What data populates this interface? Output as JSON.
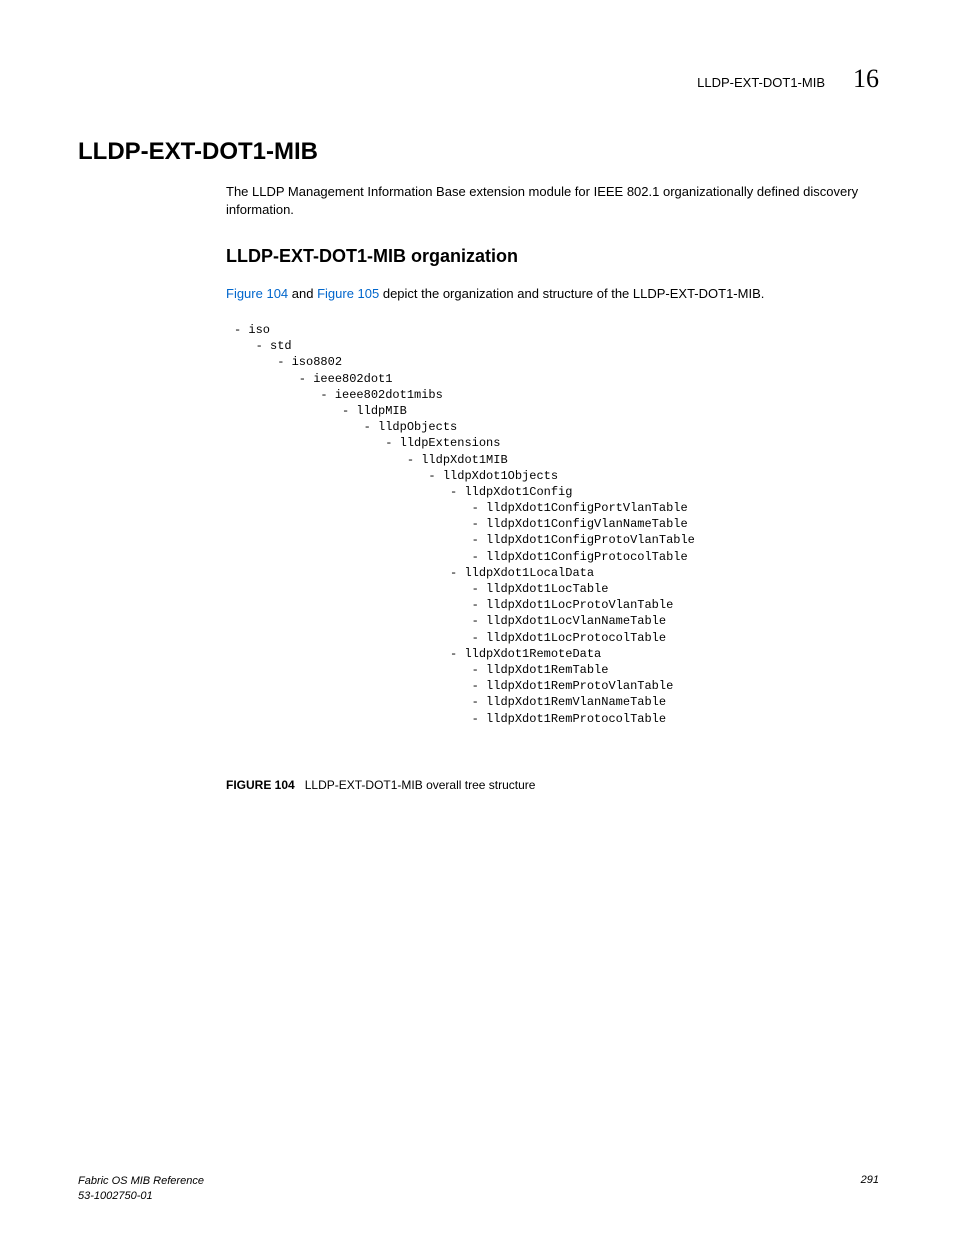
{
  "header": {
    "title": "LLDP-EXT-DOT1-MIB",
    "chapter_number": "16"
  },
  "main": {
    "heading": "LLDP-EXT-DOT1-MIB",
    "intro": "The LLDP Management Information Base extension module for IEEE 802.1 organizationally defined discovery information.",
    "subheading": "LLDP-EXT-DOT1-MIB organization",
    "depict_prefix_link1": "Figure 104",
    "depict_mid": " and ",
    "depict_link2": "Figure 105",
    "depict_suffix": " depict the organization and structure of the LLDP-EXT-DOT1-MIB."
  },
  "tree_text": "- iso\n   - std\n      - iso8802\n         - ieee802dot1\n            - ieee802dot1mibs\n               - lldpMIB\n                  - lldpObjects\n                     - lldpExtensions\n                        - lldpXdot1MIB\n                           - lldpXdot1Objects\n                              - lldpXdot1Config\n                                 - lldpXdot1ConfigPortVlanTable\n                                 - lldpXdot1ConfigVlanNameTable\n                                 - lldpXdot1ConfigProtoVlanTable\n                                 - lldpXdot1ConfigProtocolTable\n                              - lldpXdot1LocalData\n                                 - lldpXdot1LocTable\n                                 - lldpXdot1LocProtoVlanTable\n                                 - lldpXdot1LocVlanNameTable\n                                 - lldpXdot1LocProtocolTable\n                              - lldpXdot1RemoteData\n                                 - lldpXdot1RemTable\n                                 - lldpXdot1RemProtoVlanTable\n                                 - lldpXdot1RemVlanNameTable\n                                 - lldpXdot1RemProtocolTable",
  "figure": {
    "label": "FIGURE 104",
    "caption": "LLDP-EXT-DOT1-MIB overall tree structure"
  },
  "footer": {
    "doc_title": "Fabric OS MIB Reference",
    "doc_number": "53-1002750-01",
    "page_number": "291"
  }
}
